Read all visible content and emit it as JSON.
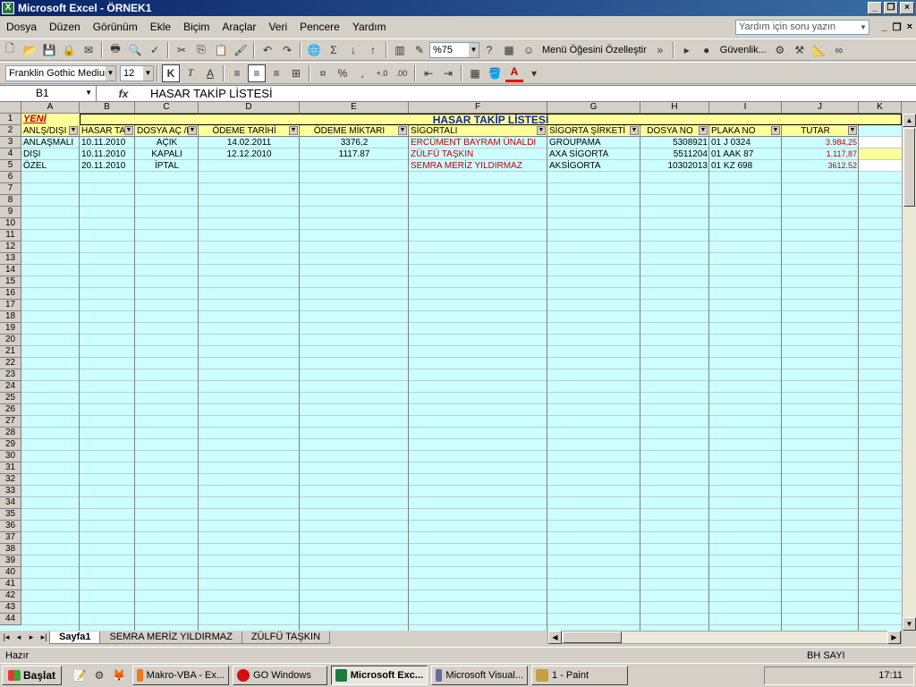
{
  "window": {
    "title": "Microsoft Excel - ÖRNEK1"
  },
  "menu": [
    "Dosya",
    "Düzen",
    "Görünüm",
    "Ekle",
    "Biçim",
    "Araçlar",
    "Veri",
    "Pencere",
    "Yardım"
  ],
  "help": {
    "placeholder": "Yardım için soru yazın"
  },
  "toolbar": {
    "zoom": "%75",
    "customize": "Menü Öğesini Özelleştir",
    "security": "Güvenlik..."
  },
  "format": {
    "font": "Franklin Gothic Medium",
    "size": "12"
  },
  "formula": {
    "cell": "B1",
    "value": "HASAR TAKİP LİSTESİ"
  },
  "columns": [
    "A",
    "B",
    "C",
    "D",
    "E",
    "F",
    "G",
    "H",
    "I",
    "J",
    "K"
  ],
  "rows": [
    "1",
    "2",
    "3",
    "4",
    "5",
    "6",
    "7",
    "8",
    "9",
    "10",
    "11",
    "12",
    "13",
    "14",
    "15",
    "16",
    "17",
    "18",
    "19",
    "20",
    "21",
    "22",
    "23",
    "24",
    "25",
    "26",
    "27",
    "28",
    "29",
    "30",
    "31",
    "32",
    "33",
    "34",
    "35",
    "36",
    "37",
    "38",
    "39",
    "40",
    "41",
    "42",
    "43",
    "44"
  ],
  "sheet": {
    "a1": "YENİ",
    "title": "HASAR TAKİP LİSTESİ",
    "headers": [
      "ANLŞ/DIŞI",
      "HASAR TA",
      "DOSYA AÇ /K",
      "ÖDEME TARİHİ",
      "ÖDEME MİKTARI",
      "SİGORTALI",
      "SİGORTA ŞİRKETİ",
      "DOSYA NO",
      "PLAKA NO",
      "TUTAR"
    ],
    "data": [
      [
        "ANLAŞMALI",
        "10.11.2010",
        "AÇIK",
        "14.02.2011",
        "3376,2",
        "ERCÜMENT BAYRAM ÜNALDI",
        "GROUPAMA",
        "5308921",
        "01 J 0324",
        "3.984,25"
      ],
      [
        "DIŞI",
        "10.11.2010",
        "KAPALI",
        "12.12.2010",
        "1117.87",
        "ZÜLFÜ TAŞKIN",
        "AXA SİGORTA",
        "5511204",
        "01 AAK 87",
        "1.117,87"
      ],
      [
        "ÖZEL",
        "20.11.2010",
        "İPTAL",
        "",
        "",
        "SEMRA MERİZ YILDIRMAZ",
        "AKSİGORTA",
        "10302013",
        "01 KZ 698",
        "3612.52"
      ]
    ]
  },
  "tabs": [
    "Sayfa1",
    "SEMRA MERİZ YILDIRMAZ",
    "ZÜLFÜ TAŞKIN"
  ],
  "status": {
    "left": "Hazır",
    "right": "BH SAYI"
  },
  "taskbar": {
    "start": "Başlat",
    "items": [
      "Makro-VBA - Ex...",
      "GO Windows",
      "Microsoft Exc...",
      "Microsoft Visual...",
      "1 - Paint"
    ],
    "time": "17:11"
  }
}
